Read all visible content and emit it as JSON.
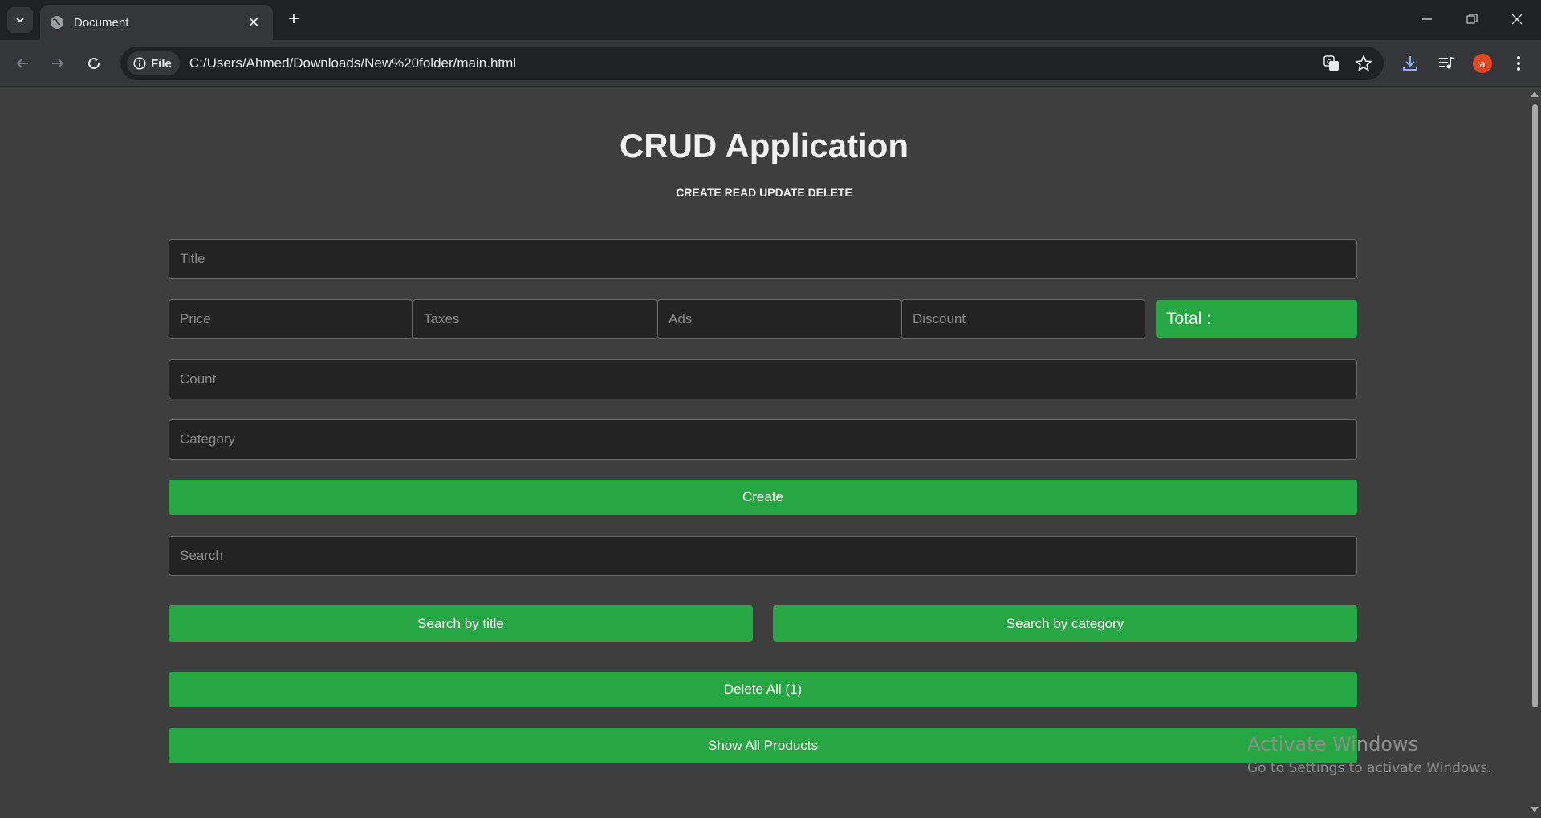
{
  "browser": {
    "tab_title": "Document",
    "file_chip": "File",
    "url": "C:/Users/Ahmed/Downloads/New%20folder/main.html",
    "profile_initial": "a"
  },
  "page": {
    "title": "CRUD Application",
    "subtitle": "CREATE READ UPDATE DELETE",
    "title_placeholder": "Title",
    "price_placeholder": "Price",
    "taxes_placeholder": "Taxes",
    "ads_placeholder": "Ads",
    "discount_placeholder": "Discount",
    "total_label": "Total :",
    "total_value": "",
    "count_placeholder": "Count",
    "category_placeholder": "Category",
    "create_label": "Create",
    "search_placeholder": "Search",
    "search_title_label": "Search by title",
    "search_category_label": "Search by category",
    "delete_all_label": "Delete All (1)",
    "show_all_label": "Show All Products"
  },
  "watermark": {
    "line1": "Activate Windows",
    "line2": "Go to Settings to activate Windows."
  },
  "colors": {
    "accent_green": "#27a644",
    "page_bg": "#3e3e3e",
    "input_bg": "#232323"
  }
}
